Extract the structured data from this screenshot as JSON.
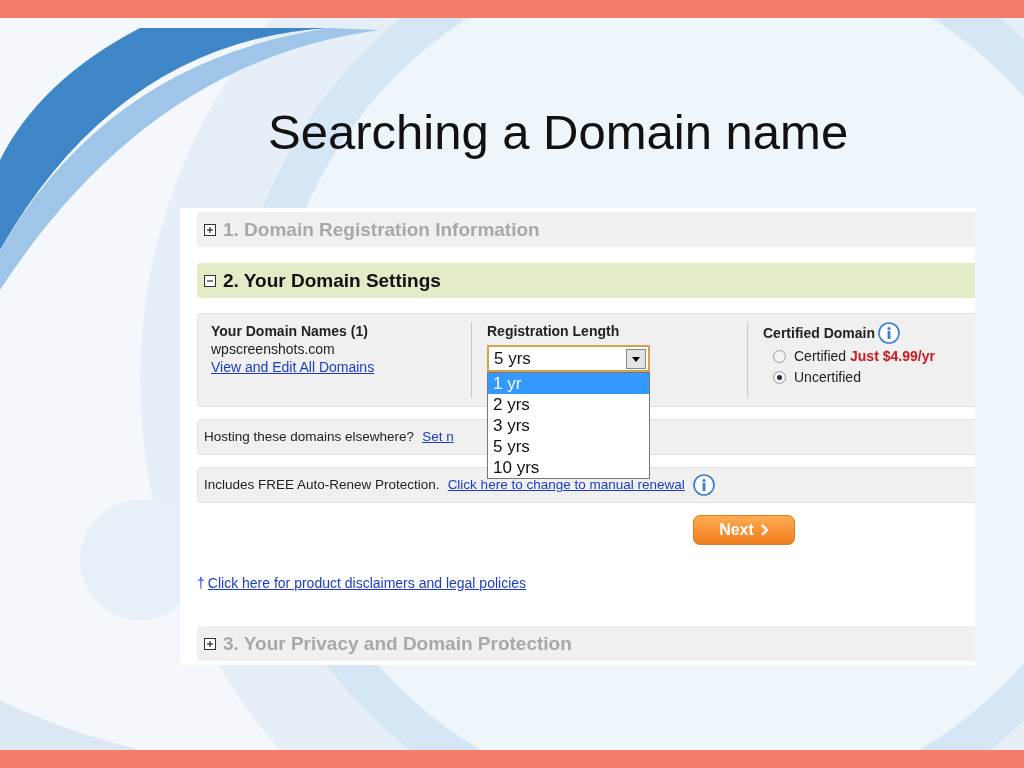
{
  "slide_title": "Searching a Domain name",
  "sections": [
    {
      "heading": "1. Domain Registration Information",
      "expanded": false
    },
    {
      "heading": "2. Your Domain Settings",
      "expanded": true
    },
    {
      "heading": "3. Your Privacy and Domain Protection",
      "expanded": false
    }
  ],
  "domain_settings": {
    "names_heading": "Your Domain Names (1)",
    "domain": "wpscreenshots.com",
    "view_link": "View and Edit All Domains",
    "length_heading": "Registration Length",
    "length_select": {
      "value": "5 yrs",
      "expanded": true,
      "options": [
        {
          "label": "1 yr",
          "highlighted": true
        },
        {
          "label": "2 yrs",
          "highlighted": false
        },
        {
          "label": "3 yrs",
          "highlighted": false
        },
        {
          "label": "5 yrs",
          "highlighted": false
        },
        {
          "label": "10 yrs",
          "highlighted": false
        }
      ]
    },
    "certified_heading": "Certified Domain",
    "certified_options": [
      {
        "label": "Certified",
        "price": "Just $4.99/yr",
        "selected": false
      },
      {
        "label": "Uncertified",
        "selected": true
      }
    ]
  },
  "hosting": {
    "text": "Hosting these domains elsewhere?",
    "link": "Set n"
  },
  "renewal": {
    "text": "Includes FREE Auto-Renew Protection.",
    "link": "Click here to change to manual renewal"
  },
  "next_button": "Next",
  "disclaimer": {
    "mark": "†",
    "link": "Click here for product disclaimers and legal policies"
  }
}
